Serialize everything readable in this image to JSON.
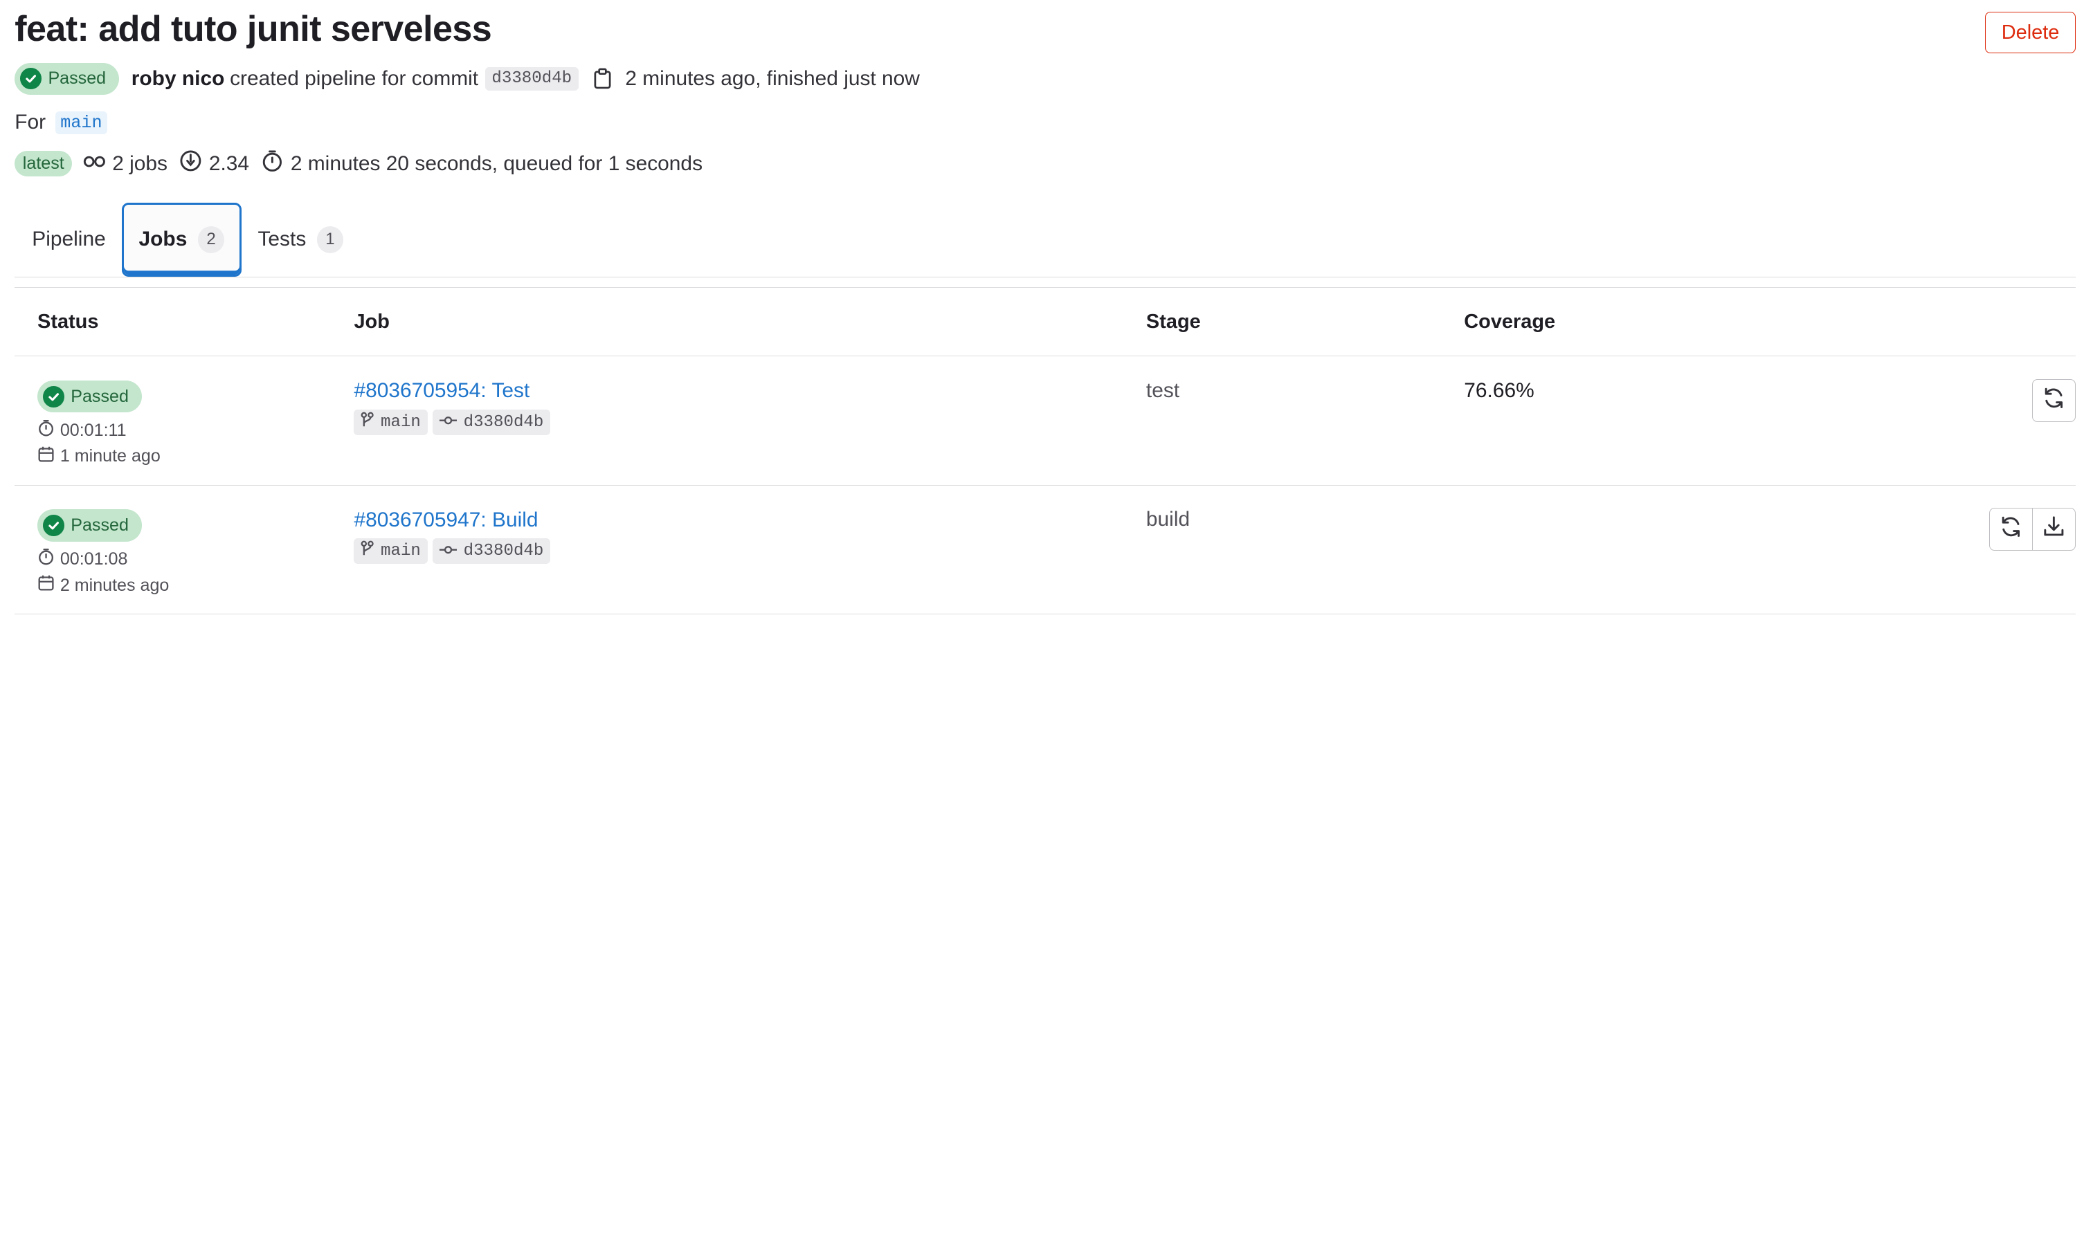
{
  "pipeline": {
    "title": "feat: add tuto junit serveless",
    "delete_label": "Delete",
    "status_label": "Passed",
    "author": "roby nico",
    "created_text": "created pipeline for commit",
    "commit_sha": "d3380d4b",
    "time_text": "2 minutes ago, finished just now",
    "for_label": "For",
    "branch": "main",
    "latest_label": "latest",
    "jobs_count_text": "2 jobs",
    "compute_text": "2.34",
    "duration_text": "2 minutes 20 seconds, queued for 1 seconds"
  },
  "tabs": [
    {
      "label": "Pipeline"
    },
    {
      "label": "Jobs",
      "count": "2",
      "active": true
    },
    {
      "label": "Tests",
      "count": "1"
    }
  ],
  "table": {
    "headers": {
      "status": "Status",
      "job": "Job",
      "stage": "Stage",
      "coverage": "Coverage"
    },
    "rows": [
      {
        "status": "Passed",
        "duration": "00:01:11",
        "finished": "1 minute ago",
        "job": "#8036705954: Test",
        "branch": "main",
        "sha": "d3380d4b",
        "stage": "test",
        "coverage": "76.66%",
        "actions": [
          "retry-icon"
        ]
      },
      {
        "status": "Passed",
        "duration": "00:01:08",
        "finished": "2 minutes ago",
        "job": "#8036705947: Build",
        "branch": "main",
        "sha": "d3380d4b",
        "stage": "build",
        "coverage": "",
        "actions": [
          "retry-icon",
          "download-icon"
        ]
      }
    ]
  },
  "colors": {
    "success": "#108548",
    "success_bg": "#c3e6cd",
    "link": "#1f75cb",
    "danger": "#dd2b0e"
  }
}
